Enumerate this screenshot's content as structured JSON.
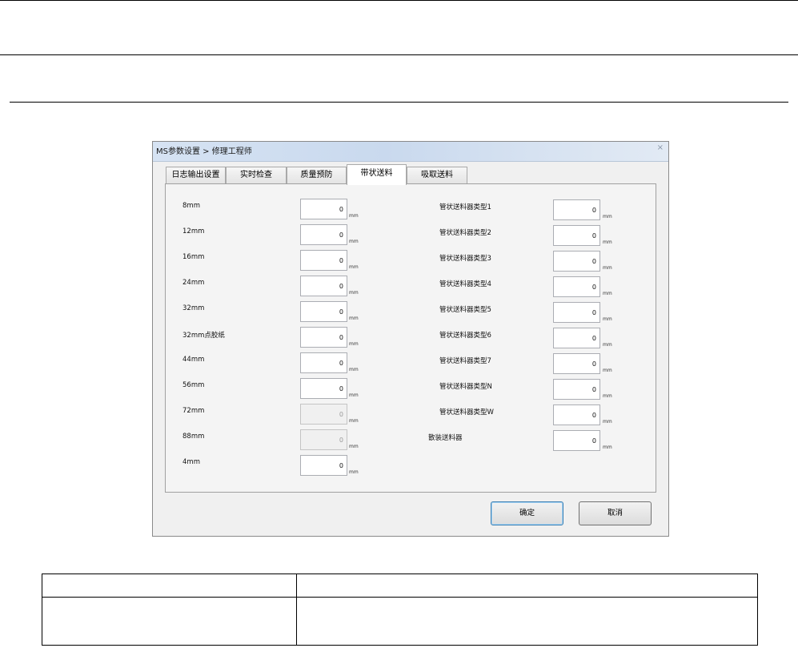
{
  "dialog": {
    "title": "MS参数设置 > 修理工程师",
    "close_symbol": "×",
    "tabs": [
      {
        "label": "日志输出设置",
        "active": false
      },
      {
        "label": "实时检查",
        "active": false
      },
      {
        "label": "质量预防",
        "active": false
      },
      {
        "label": "带状送料",
        "active": true
      },
      {
        "label": "吸取送料",
        "active": false
      }
    ],
    "left_fields": [
      {
        "label": "8mm",
        "value": "0",
        "unit": "mm",
        "disabled": false
      },
      {
        "label": "12mm",
        "value": "0",
        "unit": "mm",
        "disabled": false
      },
      {
        "label": "16mm",
        "value": "0",
        "unit": "mm",
        "disabled": false
      },
      {
        "label": "24mm",
        "value": "0",
        "unit": "mm",
        "disabled": false
      },
      {
        "label": "32mm",
        "value": "0",
        "unit": "mm",
        "disabled": false
      },
      {
        "label": "32mm点胶纸",
        "value": "0",
        "unit": "mm",
        "disabled": false
      },
      {
        "label": "44mm",
        "value": "0",
        "unit": "mm",
        "disabled": false
      },
      {
        "label": "56mm",
        "value": "0",
        "unit": "mm",
        "disabled": false
      },
      {
        "label": "72mm",
        "value": "0",
        "unit": "mm",
        "disabled": true
      },
      {
        "label": "88mm",
        "value": "0",
        "unit": "mm",
        "disabled": true
      },
      {
        "label": "4mm",
        "value": "0",
        "unit": "mm",
        "disabled": false
      }
    ],
    "right_fields": [
      {
        "label": "管状送料器类型1",
        "value": "0",
        "unit": "mm"
      },
      {
        "label": "管状送料器类型2",
        "value": "0",
        "unit": "mm"
      },
      {
        "label": "管状送料器类型3",
        "value": "0",
        "unit": "mm"
      },
      {
        "label": "管状送料器类型4",
        "value": "0",
        "unit": "mm"
      },
      {
        "label": "管状送料器类型5",
        "value": "0",
        "unit": "mm"
      },
      {
        "label": "管状送料器类型6",
        "value": "0",
        "unit": "mm"
      },
      {
        "label": "管状送料器类型7",
        "value": "0",
        "unit": "mm"
      },
      {
        "label": "管状送料器类型N",
        "value": "0",
        "unit": "mm"
      },
      {
        "label": "管状送料器类型W",
        "value": "0",
        "unit": "mm"
      },
      {
        "label": "散装送料器",
        "value": "0",
        "unit": "mm"
      }
    ],
    "buttons": {
      "ok": "确定",
      "cancel": "取消"
    }
  },
  "table": {
    "header": [
      "",
      ""
    ],
    "row": [
      "",
      ""
    ]
  }
}
